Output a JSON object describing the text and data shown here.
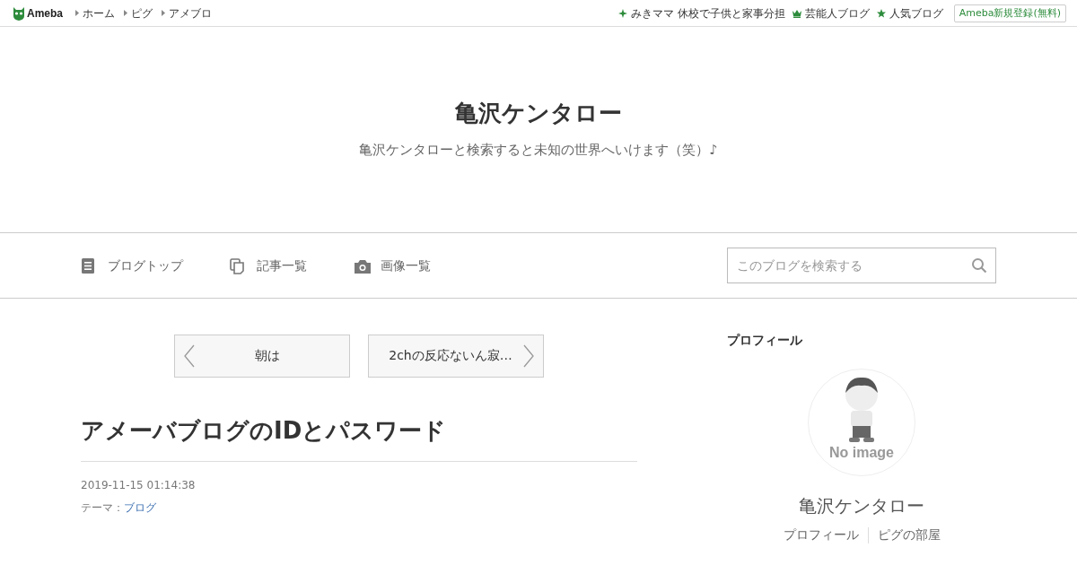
{
  "topbar": {
    "logo": "Ameba",
    "breadcrumbs": [
      "ホーム",
      "ピグ",
      "アメブロ"
    ],
    "links": [
      {
        "kind": "sparkle",
        "label": "みきママ 休校で子供と家事分担"
      },
      {
        "kind": "crown",
        "label": "芸能人ブログ"
      },
      {
        "kind": "star",
        "label": "人気ブログ"
      }
    ],
    "signup": "Ameba新規登録(無料)"
  },
  "header": {
    "title": "亀沢ケンタロー",
    "description": "亀沢ケンタローと検索すると未知の世界へいけます（笑）♪"
  },
  "nav": {
    "items": [
      {
        "kind": "list",
        "label": "ブログトップ"
      },
      {
        "kind": "copy",
        "label": "記事一覧"
      },
      {
        "kind": "camera",
        "label": "画像一覧"
      }
    ],
    "search": {
      "placeholder": "このブログを検索する"
    }
  },
  "pager": {
    "prev": "朝は",
    "next": "2chの反応ないん寂…"
  },
  "article": {
    "title": "アメーバブログのIDとパスワード",
    "date": "2019-11-15 01:14:38",
    "theme_label": "テーマ：",
    "theme": "ブログ"
  },
  "sidebar": {
    "heading": "プロフィール",
    "avatar_text": "No image",
    "name": "亀沢ケンタロー",
    "links": [
      "プロフィール",
      "ピグの部屋"
    ]
  }
}
